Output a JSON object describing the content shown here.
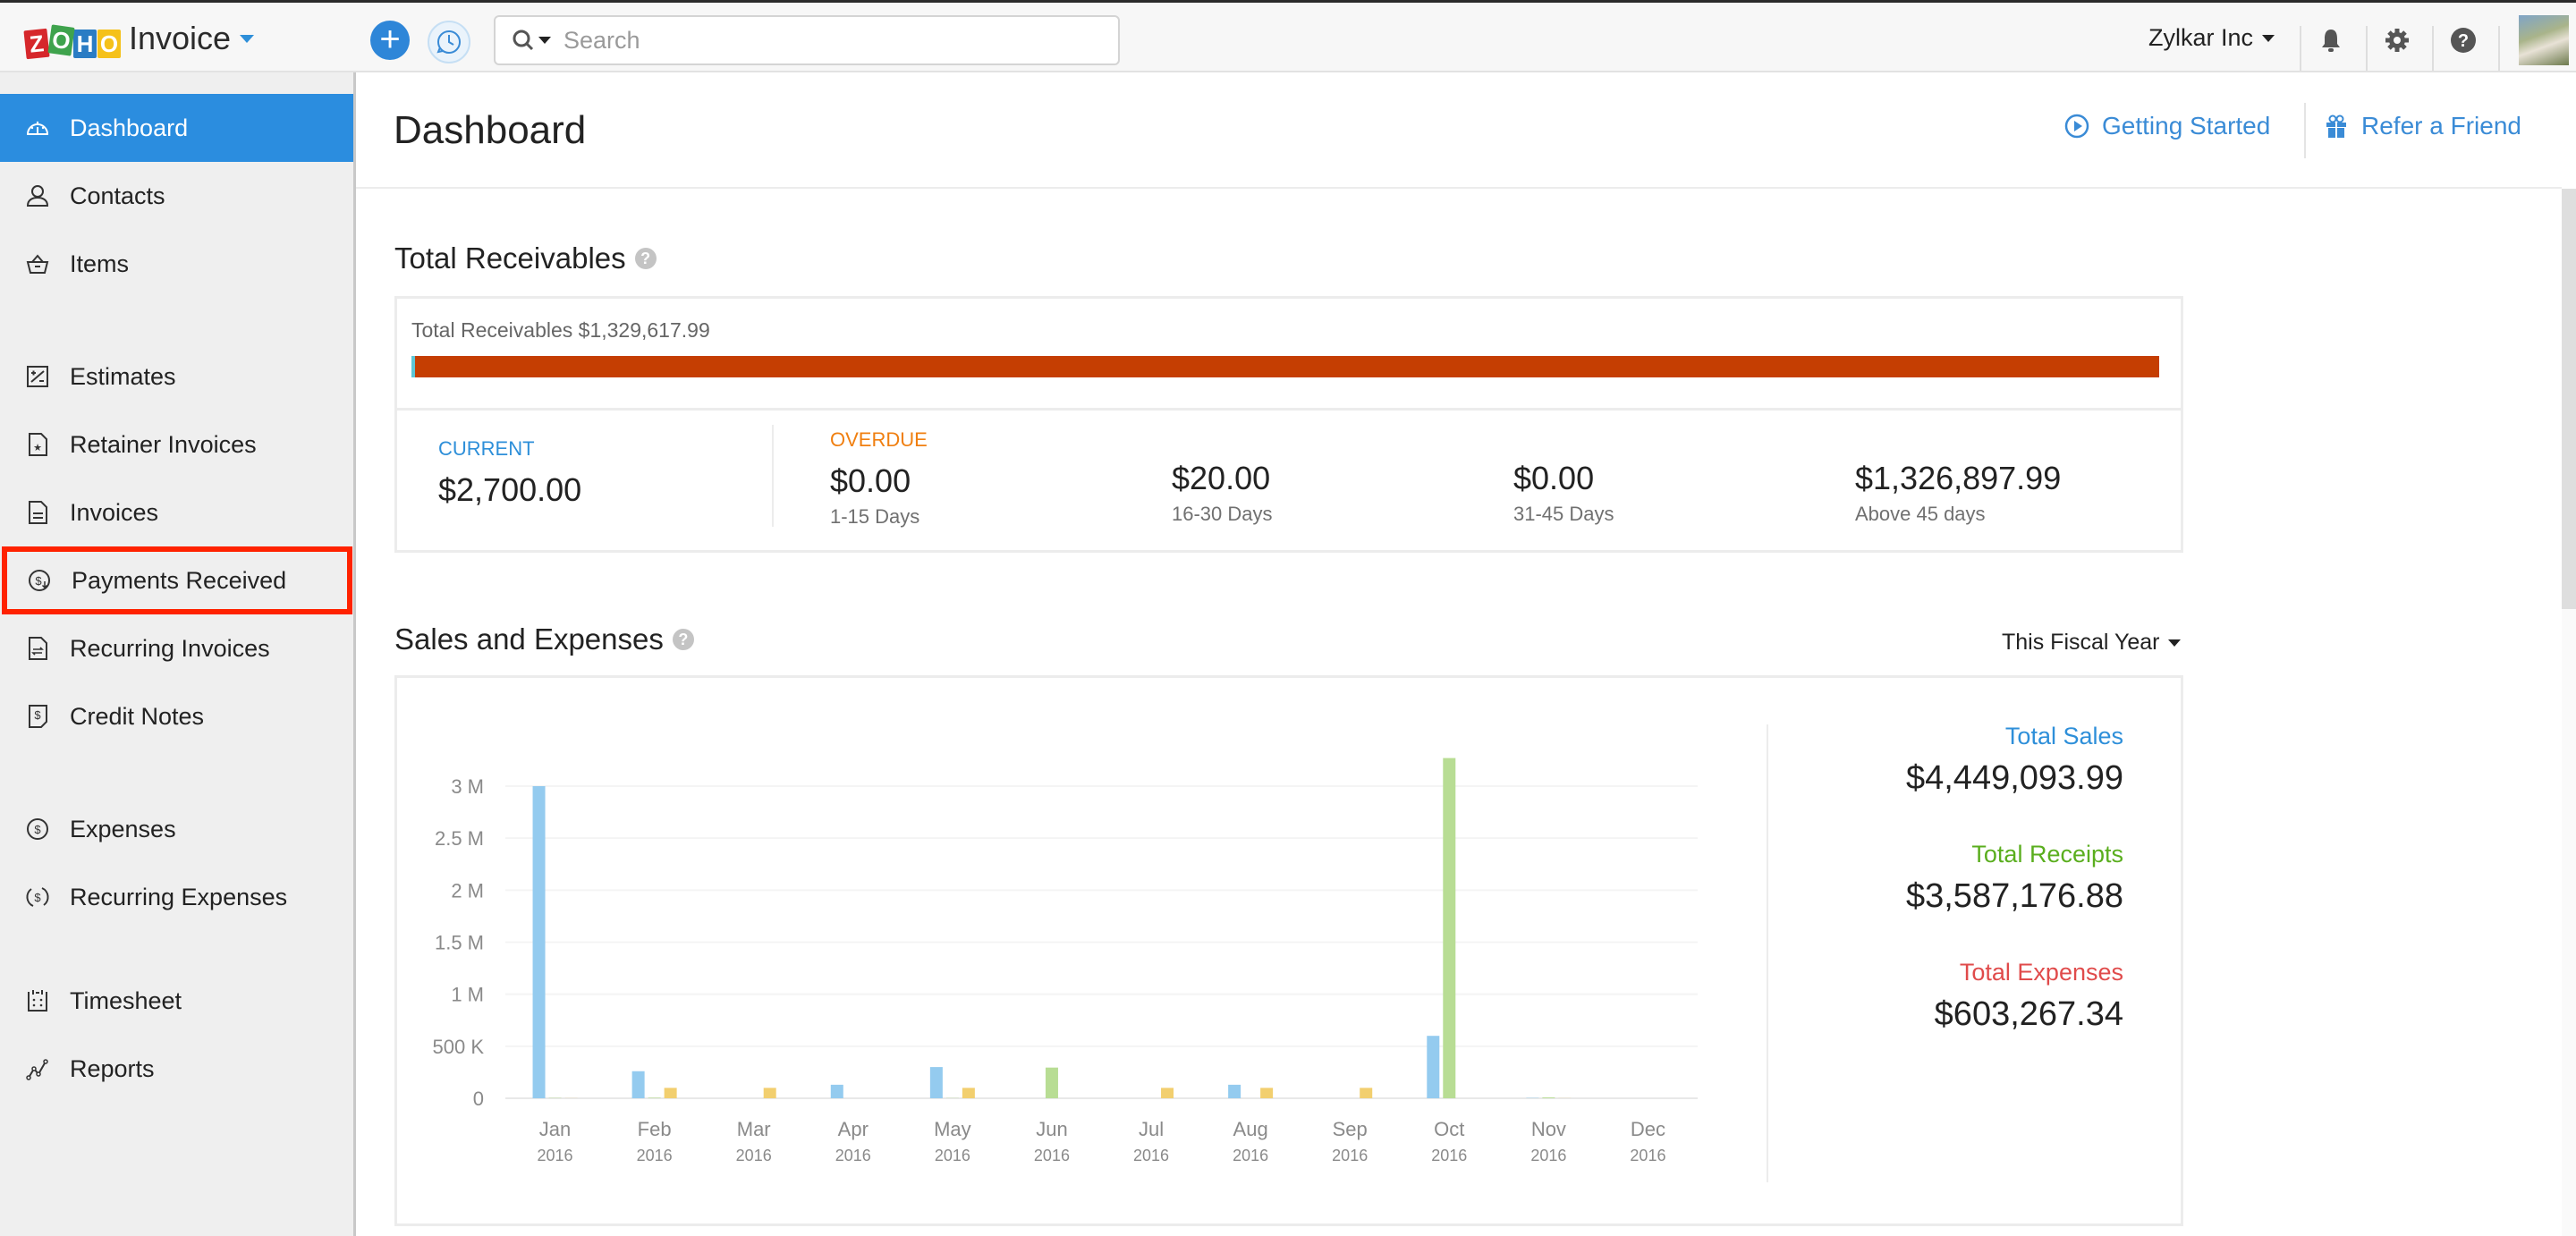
{
  "topbar": {
    "logo_letters": [
      "Z",
      "O",
      "H",
      "O"
    ],
    "app_name": "Invoice",
    "new_button_icon": "plus-icon",
    "recent_button_icon": "history-icon",
    "search": {
      "placeholder": "Search",
      "value": ""
    },
    "organization": "Zylkar Inc",
    "icons": [
      "bell-icon",
      "gear-icon",
      "help-icon"
    ]
  },
  "sidebar": {
    "items": [
      {
        "label": "Dashboard",
        "icon": "dashboard-icon",
        "active": true
      },
      {
        "label": "Contacts",
        "icon": "contacts-icon"
      },
      {
        "label": "Items",
        "icon": "basket-icon"
      },
      {
        "label": "Estimates",
        "icon": "estimates-icon"
      },
      {
        "label": "Retainer Invoices",
        "icon": "retainer-icon"
      },
      {
        "label": "Invoices",
        "icon": "invoice-icon"
      },
      {
        "label": "Payments Received",
        "icon": "payment-icon",
        "highlighted": true
      },
      {
        "label": "Recurring Invoices",
        "icon": "recurring-invoice-icon"
      },
      {
        "label": "Credit Notes",
        "icon": "credit-note-icon"
      },
      {
        "label": "Expenses",
        "icon": "expense-icon"
      },
      {
        "label": "Recurring Expenses",
        "icon": "recurring-expense-icon"
      },
      {
        "label": "Timesheet",
        "icon": "timesheet-icon"
      },
      {
        "label": "Reports",
        "icon": "reports-icon"
      }
    ]
  },
  "header": {
    "title": "Dashboard",
    "getting_started": "Getting Started",
    "refer_friend": "Refer a Friend"
  },
  "receivables": {
    "title": "Total Receivables",
    "summary_label": "Total Receivables $1,329,617.99",
    "current_fraction": 0.002,
    "current": {
      "label": "CURRENT",
      "amount": "$2,700.00"
    },
    "overdue_label": "OVERDUE",
    "overdue": [
      {
        "amount": "$0.00",
        "range": "1-15 Days"
      },
      {
        "amount": "$20.00",
        "range": "16-30 Days"
      },
      {
        "amount": "$0.00",
        "range": "31-45 Days"
      },
      {
        "amount": "$1,326,897.99",
        "range": "Above 45 days"
      }
    ],
    "colors": {
      "current": "#5ec6d6",
      "overdue": "#c53e02"
    }
  },
  "sales": {
    "title": "Sales and Expenses",
    "period": "This Fiscal Year",
    "totals": [
      {
        "label": "Total Sales",
        "value": "$4,449,093.99",
        "color": "#2e8fd9"
      },
      {
        "label": "Total Receipts",
        "value": "$3,587,176.88",
        "color": "#5aae1e"
      },
      {
        "label": "Total Expenses",
        "value": "$603,267.34",
        "color": "#e04b4b"
      }
    ]
  },
  "chart_data": {
    "type": "bar",
    "title": "Sales and Expenses",
    "categories": [
      "Jan",
      "Feb",
      "Mar",
      "Apr",
      "May",
      "Jun",
      "Jul",
      "Aug",
      "Sep",
      "Oct",
      "Nov",
      "Dec"
    ],
    "category_sublabels": [
      "2016",
      "2016",
      "2016",
      "2016",
      "2016",
      "2016",
      "2016",
      "2016",
      "2016",
      "2016",
      "2016",
      "2016"
    ],
    "series": [
      {
        "name": "Sales",
        "color": "#94cbef",
        "values": [
          3000000,
          260000,
          0,
          130000,
          300000,
          0,
          0,
          130000,
          0,
          600000,
          3000,
          0
        ]
      },
      {
        "name": "Receipts",
        "color": "#b8dd94",
        "values": [
          3000,
          5000,
          0,
          0,
          2000,
          295000,
          0,
          0,
          0,
          3270000,
          8000,
          0
        ]
      },
      {
        "name": "Expenses",
        "color": "#f2cf6f",
        "values": [
          1000,
          100000,
          100000,
          0,
          100000,
          0,
          100000,
          100000,
          100000,
          0,
          1000,
          0
        ]
      }
    ],
    "yticks": [
      "0",
      "500 K",
      "1 M",
      "1.5 M",
      "2 M",
      "2.5 M",
      "3 M"
    ],
    "ytick_values": [
      0,
      500000,
      1000000,
      1500000,
      2000000,
      2500000,
      3000000
    ],
    "ylim": [
      0,
      3300000
    ],
    "xlabel": "",
    "ylabel": "",
    "grid": true,
    "legend": "none"
  }
}
